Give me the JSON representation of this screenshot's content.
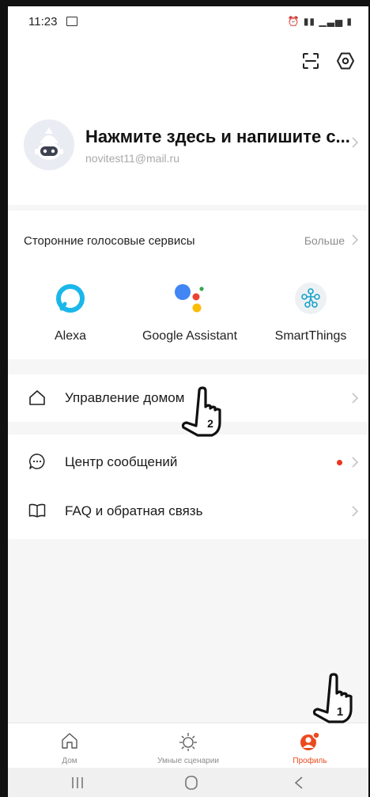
{
  "status_bar": {
    "time": "11:23"
  },
  "profile": {
    "name": "Нажмите здесь и напишите с...",
    "email": "novitest11@mail.ru"
  },
  "voice_services": {
    "title": "Сторонние голосовые сервисы",
    "more_label": "Больше",
    "items": [
      {
        "label": "Alexa",
        "icon": "alexa-icon"
      },
      {
        "label": "Google Assistant",
        "icon": "google-assistant-icon"
      },
      {
        "label": "SmartThings",
        "icon": "smartthings-icon"
      }
    ]
  },
  "menu": {
    "home_management": "Управление домом",
    "message_center": "Центр сообщений",
    "faq": "FAQ и обратная связь"
  },
  "annotations": {
    "step1": "1",
    "step2": "2"
  },
  "bottom_nav": {
    "home": "Дом",
    "scenes": "Умные сценарии",
    "profile": "Профиль"
  },
  "colors": {
    "accent": "#ea4a1e",
    "notification_dot": "#e8361f"
  }
}
